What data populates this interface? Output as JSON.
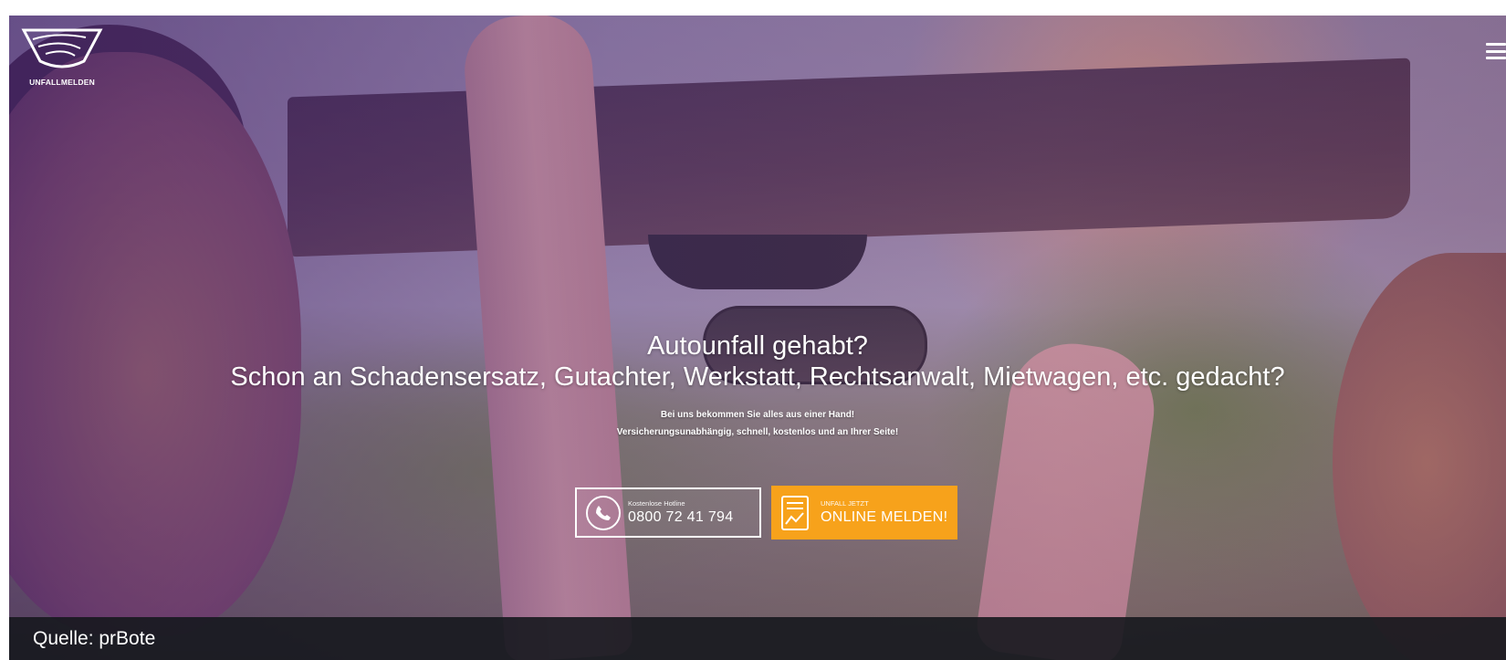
{
  "logo": {
    "text": "UNFALLMELDEN"
  },
  "menu": {
    "icon": "hamburger-menu-icon"
  },
  "hero": {
    "headline_line1": "Autounfall gehabt?",
    "headline_line2": "Schon an Schadensersatz, Gutachter, Werkstatt, Rechtsanwalt, Mietwagen, etc. gedacht?",
    "sub_line1": "Bei uns bekommen Sie alles aus einer Hand!",
    "sub_line2": "Versicherungsunabhängig, schnell, kostenlos und an Ihrer Seite!"
  },
  "hotline_button": {
    "label_small": "Kostenlose Hotline",
    "label_big": "0800 72 41 794",
    "icon": "phone-icon"
  },
  "report_button": {
    "label_small": "UNFALL JETZT",
    "label_big": "ONLINE MELDEN!",
    "icon": "document-icon",
    "color": "#f7a21b"
  },
  "caption": {
    "text": "Quelle: prBote"
  }
}
